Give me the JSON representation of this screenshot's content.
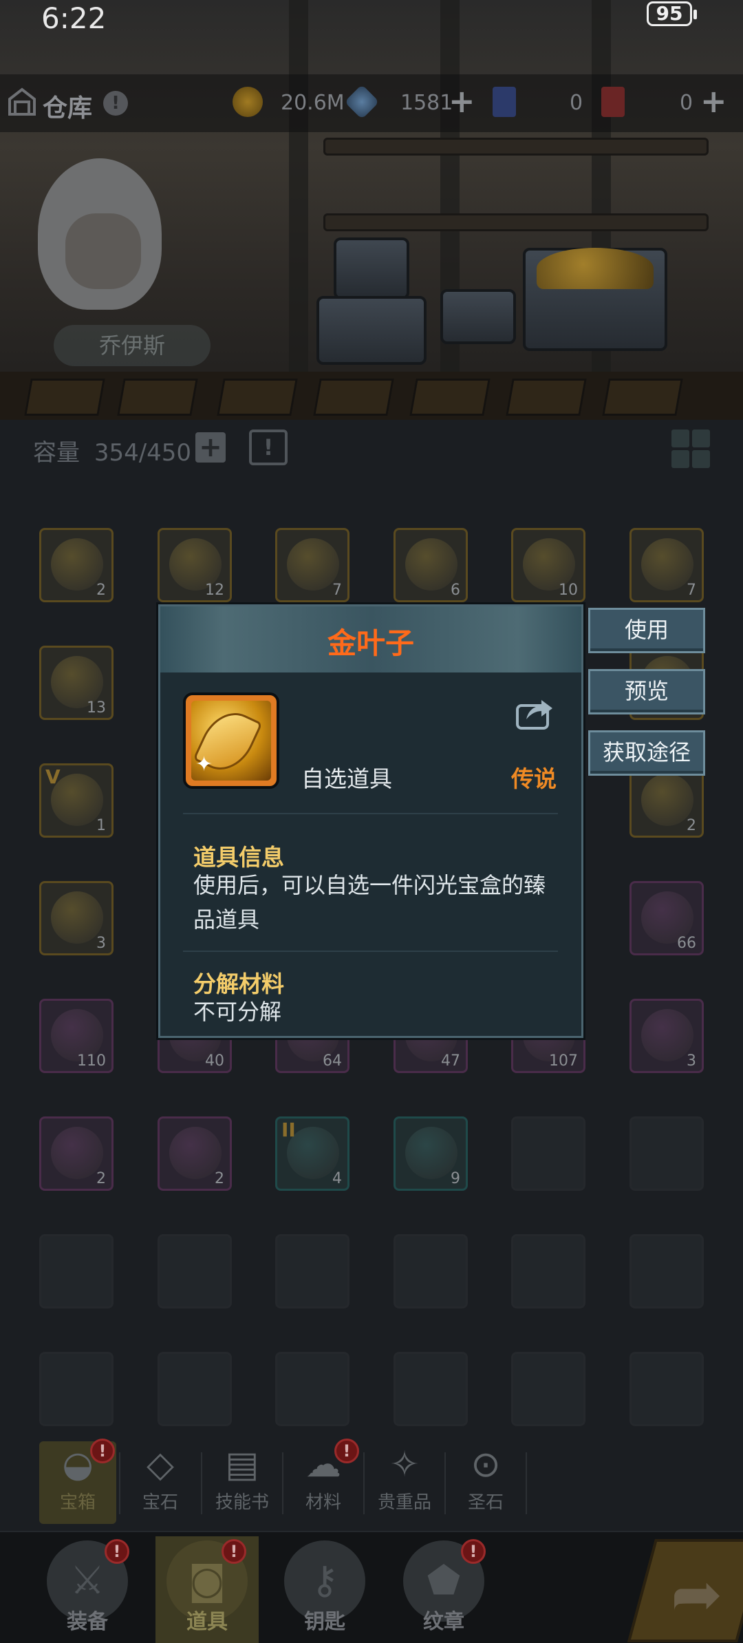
{
  "status_bar": {
    "time": "6:22",
    "battery": "95"
  },
  "topbar": {
    "title": "仓库",
    "help": "!",
    "gold": "20.6M",
    "gems": "1581",
    "tickets_blue": "0",
    "tickets_red": "0"
  },
  "hero": {
    "name": "乔伊斯"
  },
  "inventory": {
    "capacity_label": "容量",
    "capacity_value": "354/450",
    "rows": [
      [
        {
          "q": "orange",
          "count": "2"
        },
        {
          "q": "orange",
          "count": "12"
        },
        {
          "q": "orange",
          "count": "7"
        },
        {
          "q": "orange",
          "count": "6"
        },
        {
          "q": "orange",
          "count": "10"
        },
        {
          "q": "orange",
          "count": "7"
        }
      ],
      [
        {
          "q": "orange",
          "count": "13"
        },
        {
          "q": "none"
        },
        {
          "q": "none"
        },
        {
          "q": "none"
        },
        {
          "q": "none"
        },
        {
          "q": "orange",
          "count": ""
        }
      ],
      [
        {
          "q": "orange",
          "count": "1",
          "tier": "V"
        },
        {
          "q": "none"
        },
        {
          "q": "none"
        },
        {
          "q": "none"
        },
        {
          "q": "none"
        },
        {
          "q": "orange",
          "count": "2"
        }
      ],
      [
        {
          "q": "orange",
          "count": "3"
        },
        {
          "q": "none"
        },
        {
          "q": "none"
        },
        {
          "q": "none"
        },
        {
          "q": "none"
        },
        {
          "q": "purple",
          "count": "66"
        }
      ],
      [
        {
          "q": "purple",
          "count": "110"
        },
        {
          "q": "purple",
          "count": "40"
        },
        {
          "q": "purple",
          "count": "64"
        },
        {
          "q": "purple",
          "count": "47"
        },
        {
          "q": "purple",
          "count": "107"
        },
        {
          "q": "purple",
          "count": "3"
        }
      ],
      [
        {
          "q": "purple",
          "count": "2"
        },
        {
          "q": "purple",
          "count": "2"
        },
        {
          "q": "teal",
          "count": "4",
          "tier": "II"
        },
        {
          "q": "teal",
          "count": "9"
        },
        {
          "q": "empty"
        },
        {
          "q": "empty"
        }
      ],
      [
        {
          "q": "empty"
        },
        {
          "q": "empty"
        },
        {
          "q": "empty"
        },
        {
          "q": "empty"
        },
        {
          "q": "empty"
        },
        {
          "q": "empty"
        }
      ],
      [
        {
          "q": "empty"
        },
        {
          "q": "empty"
        },
        {
          "q": "empty"
        },
        {
          "q": "empty"
        },
        {
          "q": "empty"
        },
        {
          "q": "empty"
        }
      ]
    ]
  },
  "modal": {
    "title": "金叶子",
    "item_type": "自选道具",
    "rarity": "传说",
    "info_title": "道具信息",
    "info_body": "使用后，可以自选一件闪光宝盒的臻品道具",
    "decompose_title": "分解材料",
    "decompose_body": "不可分解",
    "colors": {
      "title": "#ff6a1a",
      "rarity": "#f08a24",
      "section": "#f3cc6a"
    }
  },
  "side_buttons": {
    "use": "使用",
    "preview": "预览",
    "source": "获取途径"
  },
  "categories": [
    {
      "label": "宝箱",
      "icon": "chest-icon",
      "badge": "!"
    },
    {
      "label": "宝石",
      "icon": "gem-icon"
    },
    {
      "label": "技能书",
      "icon": "book-icon"
    },
    {
      "label": "材料",
      "icon": "material-icon",
      "badge": "!"
    },
    {
      "label": "贵重品",
      "icon": "valuable-icon"
    },
    {
      "label": "圣石",
      "icon": "holy-stone-icon"
    }
  ],
  "bottom_nav": [
    {
      "label": "装备",
      "icon": "equipment-icon",
      "badge": "!"
    },
    {
      "label": "道具",
      "icon": "item-bag-icon",
      "badge": "!"
    },
    {
      "label": "钥匙",
      "icon": "key-icon"
    },
    {
      "label": "纹章",
      "icon": "emblem-icon",
      "badge": "!"
    }
  ]
}
